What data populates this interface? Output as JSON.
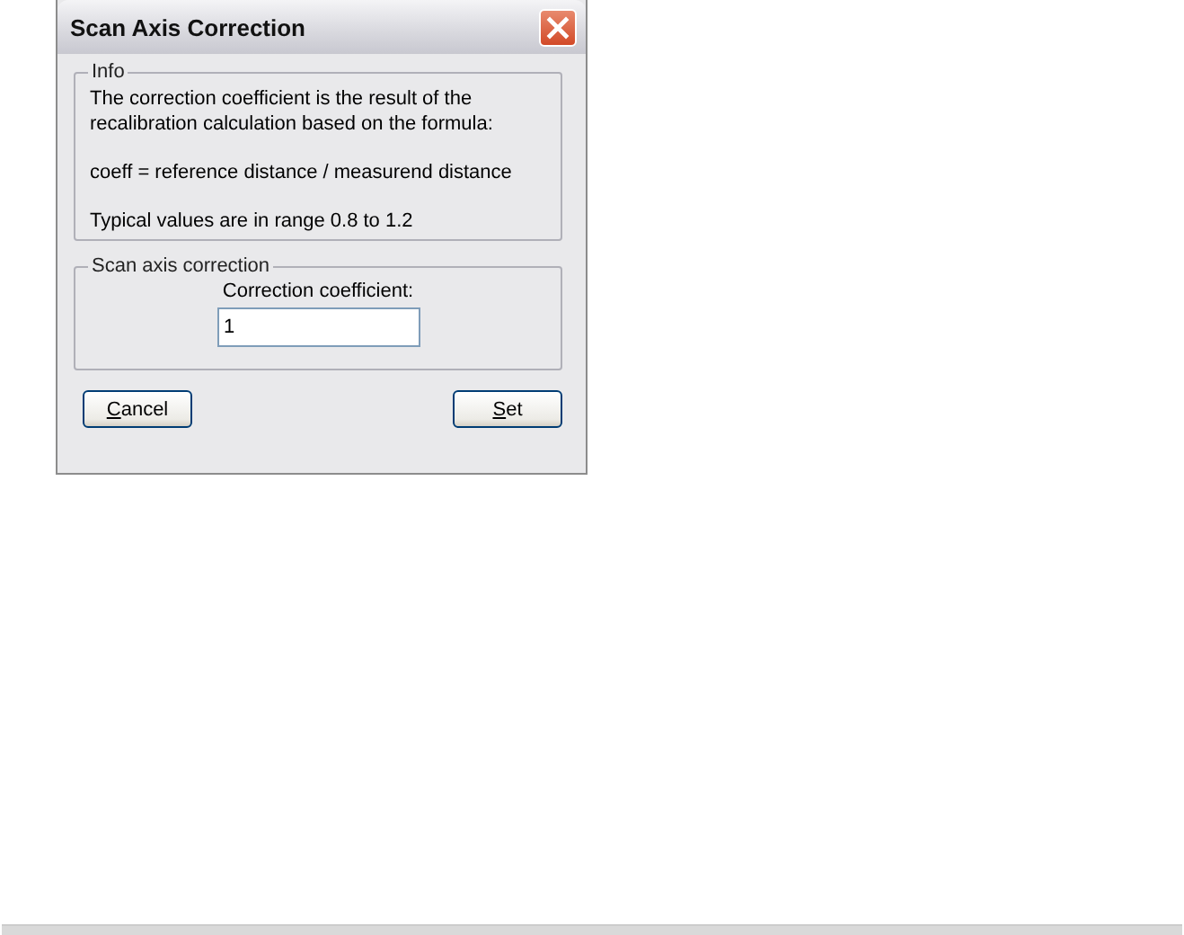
{
  "window": {
    "title": "Scan Axis Correction"
  },
  "info_group": {
    "title": "Info",
    "paragraphs": [
      "The correction coefficient is the result of the recalibration calculation based on the formula:",
      " coeff = reference distance / measurend distance",
      "Typical values are in range 0.8 to 1.2"
    ]
  },
  "correction_group": {
    "title": "Scan axis correction",
    "field_label": "Correction coefficient:",
    "value": "1"
  },
  "buttons": [
    {
      "label": "Cancel",
      "first_letter_underlined": true
    },
    {
      "label": "Set",
      "first_letter_underlined": true
    }
  ]
}
